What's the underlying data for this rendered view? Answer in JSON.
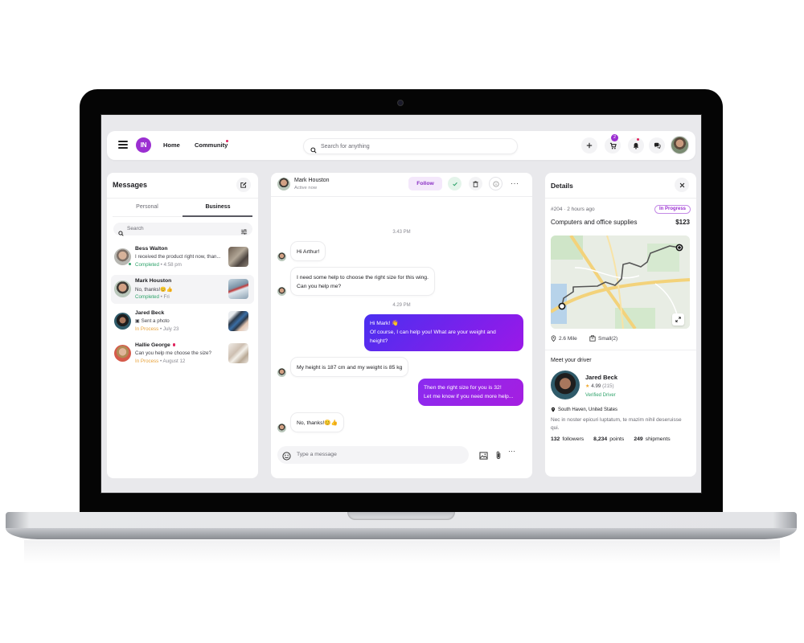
{
  "topbar": {
    "logo_text": "IN",
    "nav": [
      {
        "label": "Home"
      },
      {
        "label": "Community",
        "has_notification": true
      }
    ],
    "search_placeholder": "Search for anything",
    "cart_badge": "2",
    "icons": [
      "plus-icon",
      "cart-icon",
      "bell-icon",
      "chat-icon"
    ]
  },
  "messages": {
    "title": "Messages",
    "tabs": [
      {
        "label": "Personal",
        "active": false
      },
      {
        "label": "Business",
        "active": true
      }
    ],
    "search_placeholder": "Search",
    "conversations": [
      {
        "name": "Bess Walton",
        "preview": "I received the product right now, than...",
        "status": "Completed",
        "time": "4:58 pm",
        "online": true,
        "active": false,
        "unread": false
      },
      {
        "name": "Mark Houston",
        "preview": "No, thanks!😊👍",
        "status": "Completed",
        "time": "Fri",
        "online": false,
        "active": true,
        "unread": false
      },
      {
        "name": "Jared Beck",
        "preview": "Sent a photo",
        "status": "In Process",
        "time": "July 23",
        "online": false,
        "active": false,
        "unread": false
      },
      {
        "name": "Hallie George",
        "preview": "Can you help me choose the size?",
        "status": "In Process",
        "time": "August 12",
        "online": false,
        "active": false,
        "unread": true
      }
    ]
  },
  "chat": {
    "contact_name": "Mark Houston",
    "contact_status": "Active now",
    "follow_label": "Follow",
    "messages": [
      {
        "type": "time",
        "text": "3.43 PM"
      },
      {
        "type": "in",
        "lines": [
          "Hi Arthur!"
        ]
      },
      {
        "type": "in",
        "lines": [
          "I need some help to choose the right size for this wing.",
          "Can you help me?"
        ]
      },
      {
        "type": "time",
        "text": "4.29 PM"
      },
      {
        "type": "out",
        "lines": [
          "Hi Mark! 👋",
          "Of course, I can help you! What are your weight and",
          "height?"
        ]
      },
      {
        "type": "in",
        "lines": [
          "My height is 187 cm and my weight is 85 kg"
        ]
      },
      {
        "type": "out",
        "lines": [
          "Then the right size for you is 32!",
          "Let me know if you need more help..."
        ]
      },
      {
        "type": "in",
        "lines": [
          "No, thanks!😊👍"
        ]
      }
    ],
    "input_placeholder": "Type a message"
  },
  "details": {
    "title": "Details",
    "order_id": "#204",
    "order_time": "2 hours ago",
    "status": "In Progress",
    "order_name": "Computers and office supplies",
    "price": "$123",
    "distance": "2.6 Mile",
    "package": "Small(2)",
    "driver_heading": "Meet your driver",
    "driver": {
      "name": "Jared Beck",
      "rating": "4.99",
      "rating_count": "(215)",
      "verified": "Verified Driver",
      "location": "South Haven, United States",
      "bio": "Nec in noster epicuri luptatum, te mazim nihil deseruisse qui.",
      "stats": [
        {
          "value": "132",
          "label": "followers"
        },
        {
          "value": "8,234",
          "label": "points"
        },
        {
          "value": "249",
          "label": "shipments"
        }
      ]
    }
  },
  "colors": {
    "brand": "#9b2fd1",
    "completed": "#2fa36b",
    "in_process": "#e8a23a",
    "alert_dot": "#e0245e",
    "bubble_out_start": "#4a2ff0",
    "bubble_out_end": "#9b18e8"
  }
}
